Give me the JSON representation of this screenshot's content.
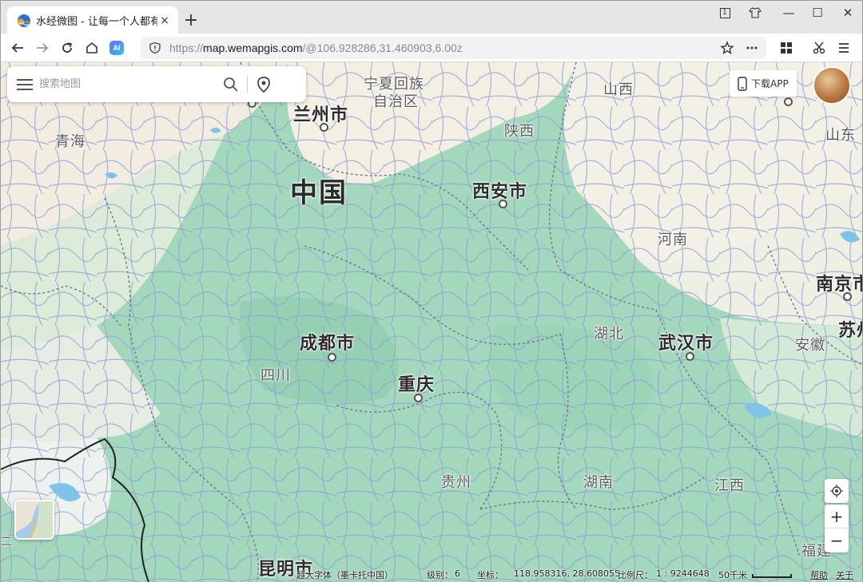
{
  "browser": {
    "tab_title": "水经微图 - 让每一个人都有自",
    "tab_close": "×",
    "new_tab": "+",
    "url_scheme": "https://",
    "url_host": "map.wemapgis.com",
    "url_path": "/@106.928286,31.460903,6.00z",
    "ai_label": "AI",
    "window_controls": [
      "1",
      "—",
      "☐",
      "✕"
    ]
  },
  "map": {
    "search_placeholder": "搜索地图",
    "download_app": "下载APP",
    "country_label": "中国",
    "provinces": [
      "青海",
      "宁夏回族",
      "自治区",
      "山西",
      "陕西",
      "山东",
      "河南",
      "湖北",
      "安徽",
      "四川",
      "贵州",
      "湖南",
      "江西",
      "福建"
    ],
    "cities": [
      "兰州市",
      "西安市",
      "成都市",
      "重庆",
      "武汉市",
      "南京市",
      "苏州",
      "昆明市"
    ],
    "zoom_in": "+",
    "zoom_out": "−",
    "partial_label": "二"
  },
  "status_bar": {
    "font_label": "超大字体（墨卡托中国）",
    "level_label": "级别：",
    "level_value": "6",
    "coord_label": "坐标：",
    "coord_value": "118.958316, 28.608055",
    "scale_label": "比例尺：",
    "scale_value": "1 : 9244648",
    "scale_text": "50千米",
    "help": "帮助",
    "about": "关于"
  },
  "colors": {
    "land_green": "#a4d8bd",
    "highland": "#c7e6cf",
    "desert": "#f3ede0",
    "water": "#7fc4e8",
    "border": "#6b7785",
    "road": "#8d9cd6"
  },
  "icons": [
    "back-arrow-icon",
    "forward-arrow-icon",
    "reload-icon",
    "home-icon",
    "shield-icon",
    "star-icon",
    "more-icon",
    "grid-icon",
    "scissors-icon",
    "menu-icon",
    "search-icon",
    "location-pin-icon",
    "phone-icon",
    "locate-icon"
  ]
}
